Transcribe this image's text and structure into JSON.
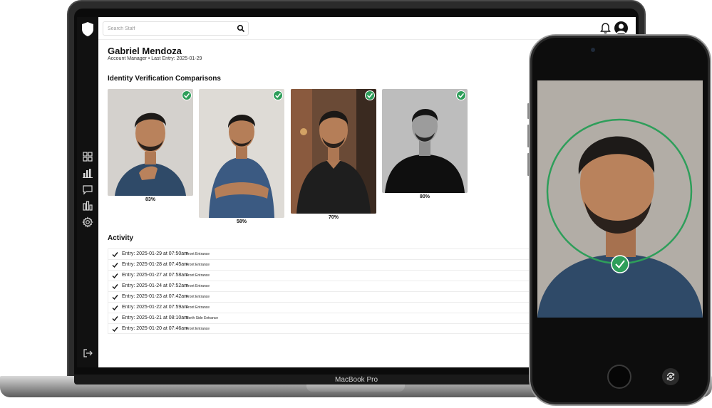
{
  "device": {
    "laptop_model": "MacBook Pro"
  },
  "app": {
    "search": {
      "placeholder": "Search Staff",
      "value": ""
    },
    "sidebar": {
      "items": [
        {
          "icon": "grid-icon"
        },
        {
          "icon": "bar-chart-icon"
        },
        {
          "icon": "chat-icon"
        },
        {
          "icon": "report-chart-icon"
        },
        {
          "icon": "gear-icon"
        }
      ],
      "footer_icon": "logout-icon"
    },
    "profile": {
      "name": "Gabriel Mendoza",
      "role": "Account Manager",
      "separator": " • ",
      "last_entry": "Last Entry: 2025-01-29"
    },
    "comparisons": {
      "title": "Identity Verification Comparisons",
      "items": [
        {
          "match": "83%",
          "verified": true,
          "style": "color"
        },
        {
          "match": "58%",
          "verified": true,
          "style": "color"
        },
        {
          "match": "70%",
          "verified": true,
          "style": "color"
        },
        {
          "match": "80%",
          "verified": true,
          "style": "grayscale"
        }
      ]
    },
    "activity": {
      "title": "Activity",
      "rows": [
        {
          "entry": "Entry: 2025-01-29 at 07:50am",
          "location": "Front Entrance"
        },
        {
          "entry": "Entry: 2025-01-28 at 07:45am",
          "location": "Front Entrance"
        },
        {
          "entry": "Entry: 2025-01-27 at 07:58am",
          "location": "Front Entrance"
        },
        {
          "entry": "Entry: 2025-01-24 at 07:52am",
          "location": "Front Entrance"
        },
        {
          "entry": "Entry: 2025-01-23 at 07:42am",
          "location": "Front Entrance"
        },
        {
          "entry": "Entry: 2025-01-22 at 07:59am",
          "location": "Front Entrance"
        },
        {
          "entry": "Entry: 2025-01-21 at 08:10am",
          "location": "North Side Entrance"
        },
        {
          "entry": "Entry: 2025-01-20 at 07:46am",
          "location": "Front Entrance"
        }
      ]
    }
  },
  "colors": {
    "verified_green": "#2e9e5a",
    "sidebar_bg": "#111111",
    "shirt_blue": "#2f4a68"
  }
}
